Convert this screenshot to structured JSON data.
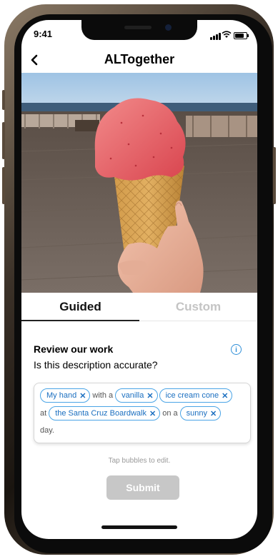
{
  "status_bar": {
    "time": "9:41",
    "wifi_icon": "wifi-icon",
    "battery_level": 0.85
  },
  "nav": {
    "back_icon": "chevron-left-icon",
    "back_glyph": "‹",
    "title": "ALTogether"
  },
  "photo": {
    "subject": "ice-cream-cone-photo"
  },
  "tabs": [
    {
      "label": "Guided",
      "active": true
    },
    {
      "label": "Custom",
      "active": false
    }
  ],
  "review": {
    "heading": "Review our work",
    "question": "Is this description accurate?",
    "info_icon": "info-icon",
    "info_glyph": "i"
  },
  "description": {
    "line1": {
      "chip1": "My hand",
      "word1": "with a",
      "chip2": "vanilla",
      "chip3": "ice cream cone"
    },
    "line2": {
      "word1": "at",
      "chip1": "the Santa Cruz Boardwalk",
      "word2": "on a",
      "chip2": "sunny"
    },
    "line3": {
      "word1": "day."
    },
    "remove_glyph": "✕"
  },
  "hint": "Tap bubbles to edit.",
  "submit_label": "Submit",
  "colors": {
    "accent": "#2f8fd8",
    "chip_border": "#4aa4e6",
    "submit_disabled": "#c7c7c7"
  }
}
